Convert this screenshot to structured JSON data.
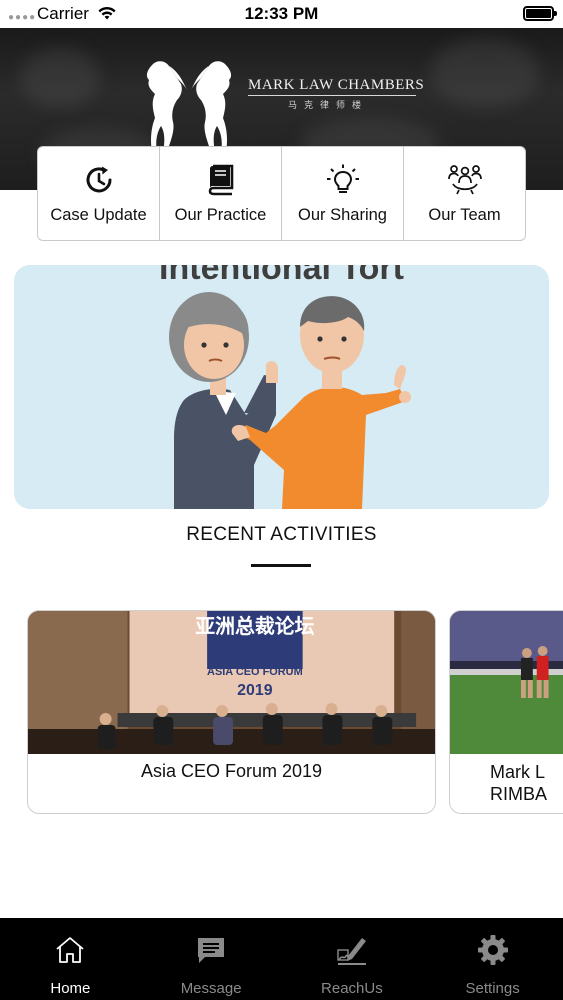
{
  "status_bar": {
    "carrier": "Carrier",
    "time": "12:33 PM",
    "signal_icon": "signal-dots-icon",
    "wifi_icon": "wifi-icon",
    "battery_icon": "battery-icon",
    "battery_level": 1.0
  },
  "header": {
    "logo_icon": "rearing-horses-logo",
    "firm_name": "MARK LAW CHAMBERS",
    "firm_name_chinese": "马克律师楼"
  },
  "quick_menu": {
    "items": [
      {
        "label": "Case Update",
        "icon": "clock-refresh-icon"
      },
      {
        "label": "Our Practice",
        "icon": "book-icon"
      },
      {
        "label": "Our Sharing",
        "icon": "lightbulb-icon"
      },
      {
        "label": "Our Team",
        "icon": "team-icon"
      }
    ]
  },
  "hero": {
    "title": "Intentional Tort"
  },
  "recent_activities": {
    "heading": "RECENT ACTIVITIES",
    "cards": [
      {
        "title": "Asia CEO Forum 2019",
        "photo_text_cn": "亚洲总裁论坛",
        "photo_text_en": "ASIA CEO FORUM",
        "photo_year": "2019"
      },
      {
        "title_line1": "Mark L",
        "title_line2": "RIMBA"
      }
    ]
  },
  "tab_bar": {
    "active": "Home",
    "items": [
      {
        "label": "Home",
        "icon": "home-icon"
      },
      {
        "label": "Message",
        "icon": "message-icon"
      },
      {
        "label": "ReachUs",
        "icon": "signature-pen-icon"
      },
      {
        "label": "Settings",
        "icon": "gear-icon"
      }
    ]
  },
  "colors": {
    "banner_background": "#1e1e1e",
    "hero_background": "#d6ebf4",
    "tab_bar_background": "#000000",
    "tab_active": "#ffffff",
    "tab_inactive": "#8a8a8a",
    "orange_shirt": "#f28a2e"
  }
}
